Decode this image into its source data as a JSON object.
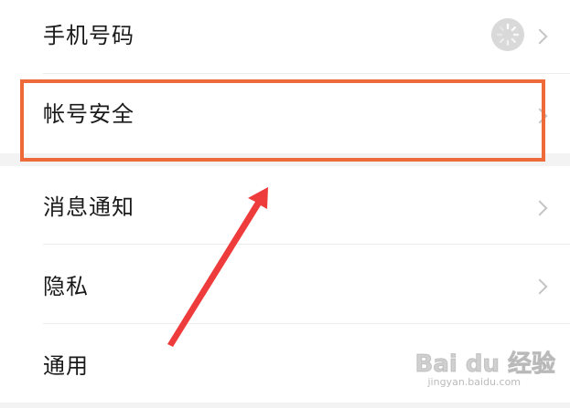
{
  "settings": {
    "items": [
      {
        "label": "手机号码"
      },
      {
        "label": "帐号安全"
      },
      {
        "label": "消息通知"
      },
      {
        "label": "隐私"
      },
      {
        "label": "通用"
      }
    ]
  },
  "watermark": {
    "main": "Bai du 经验",
    "sub": "jingyan.baidu.com"
  },
  "colors": {
    "highlight": "#ef6a3a",
    "arrow": "#ee3b3b",
    "text": "#1a1a1a",
    "chevron": "#c4c4c4"
  },
  "icons": {
    "chevron": "chevron-right-icon",
    "avatar": "loading-spinner-avatar"
  }
}
